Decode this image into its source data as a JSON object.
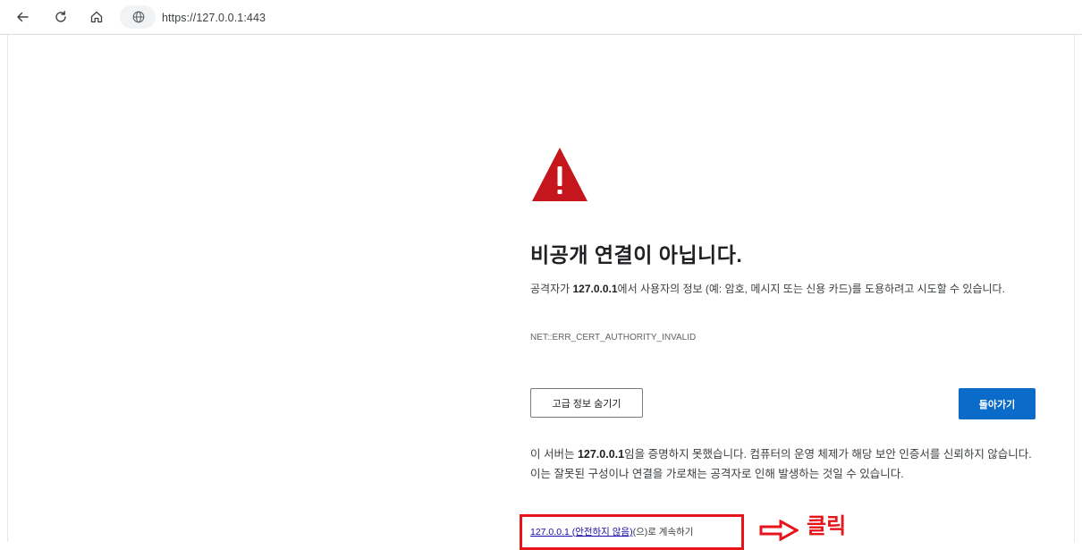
{
  "browser": {
    "url": "https://127.0.0.1:443",
    "back_icon": "back-arrow-icon",
    "reload_icon": "reload-icon",
    "home_icon": "home-icon",
    "site_icon": "globe-icon"
  },
  "warning": {
    "icon": "warning-triangle-icon",
    "icon_color": "#c5161d",
    "title": "비공개 연결이 아닙니다.",
    "desc_prefix": "공격자가 ",
    "desc_host": "127.0.0.1",
    "desc_suffix": "에서 사용자의 정보 (예: 암호, 메시지 또는 신용 카드)를 도용하려고 시도할 수 있습니다.",
    "error_code": "NET::ERR_CERT_AUTHORITY_INVALID"
  },
  "buttons": {
    "advanced_label": "고급 정보 숨기기",
    "back_label": "돌아가기",
    "back_color": "#0b6bc8"
  },
  "details": {
    "prefix": "이 서버는 ",
    "host": "127.0.0.1",
    "suffix": "임을 증명하지 못했습니다. 컴퓨터의 운영 체제가 해당 보안 인증서를 신뢰하지 않습니다. 이는 잘못된 구성이나 연결을 가로채는 공격자로 인해 발생하는 것일 수 있습니다.",
    "proceed_link": "127.0.0.1 (안전하지 않음)",
    "proceed_suffix": "(으)로 계속하기"
  },
  "annotation": {
    "label": "클릭",
    "color": "#e8141b"
  }
}
